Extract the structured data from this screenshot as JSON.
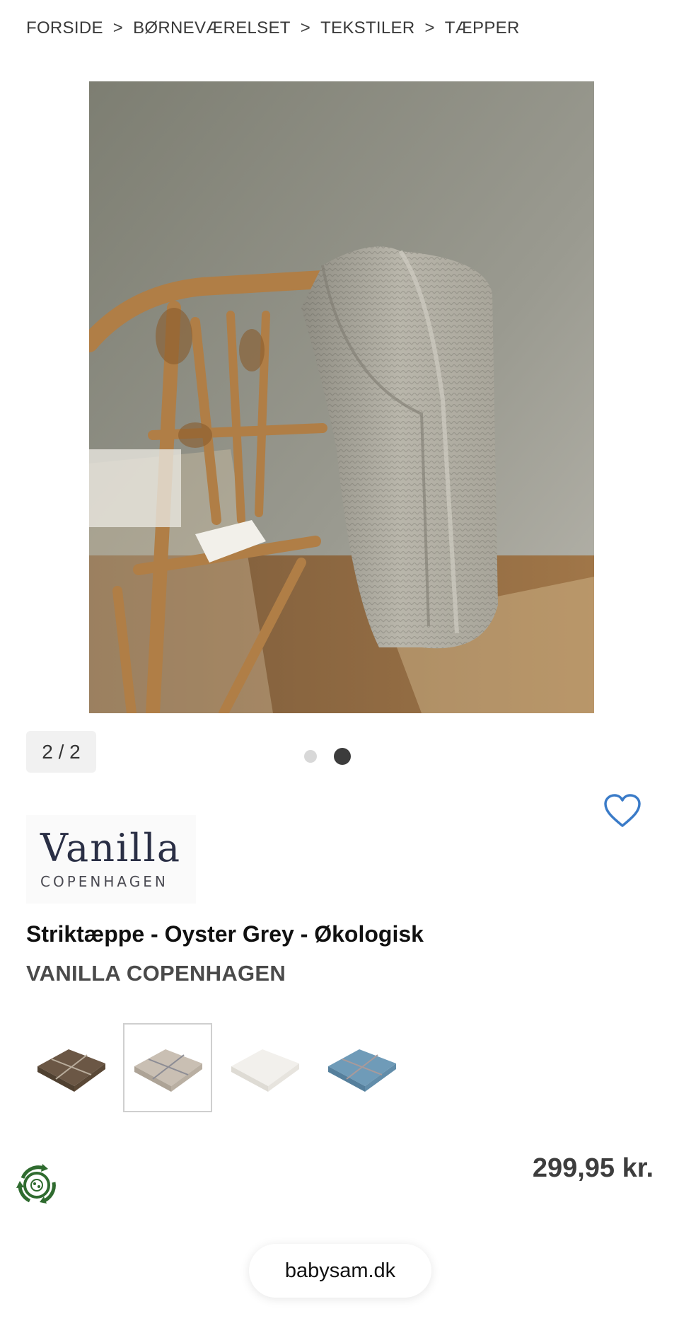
{
  "breadcrumb": {
    "items": [
      "FORSIDE",
      "BØRNEVÆRELSET",
      "TEKSTILER",
      "TÆPPER"
    ],
    "separator": ">"
  },
  "gallery": {
    "counter": "2 / 2",
    "dots_total": 2,
    "active_dot": 2
  },
  "brand_logo": {
    "script": "Vanilla",
    "sub": "COPENHAGEN"
  },
  "product": {
    "title": "Striktæppe - Oyster Grey - Økologisk",
    "brand": "VANILLA COPENHAGEN",
    "price": "299,95 kr."
  },
  "swatches": [
    {
      "name": "brown",
      "color": "#6b5745",
      "selected": false
    },
    {
      "name": "oyster-grey",
      "color": "#c9bfb3",
      "selected": true
    },
    {
      "name": "white",
      "color": "#f2f0ec",
      "selected": false
    },
    {
      "name": "blue",
      "color": "#6f9bb8",
      "selected": false
    }
  ],
  "icons": {
    "favorite": "heart-outline-icon",
    "eco": "eco-recycle-icon"
  },
  "colors": {
    "heart": "#3a7bc8",
    "eco_green": "#2f6b2f"
  },
  "browser": {
    "url": "babysam.dk"
  }
}
